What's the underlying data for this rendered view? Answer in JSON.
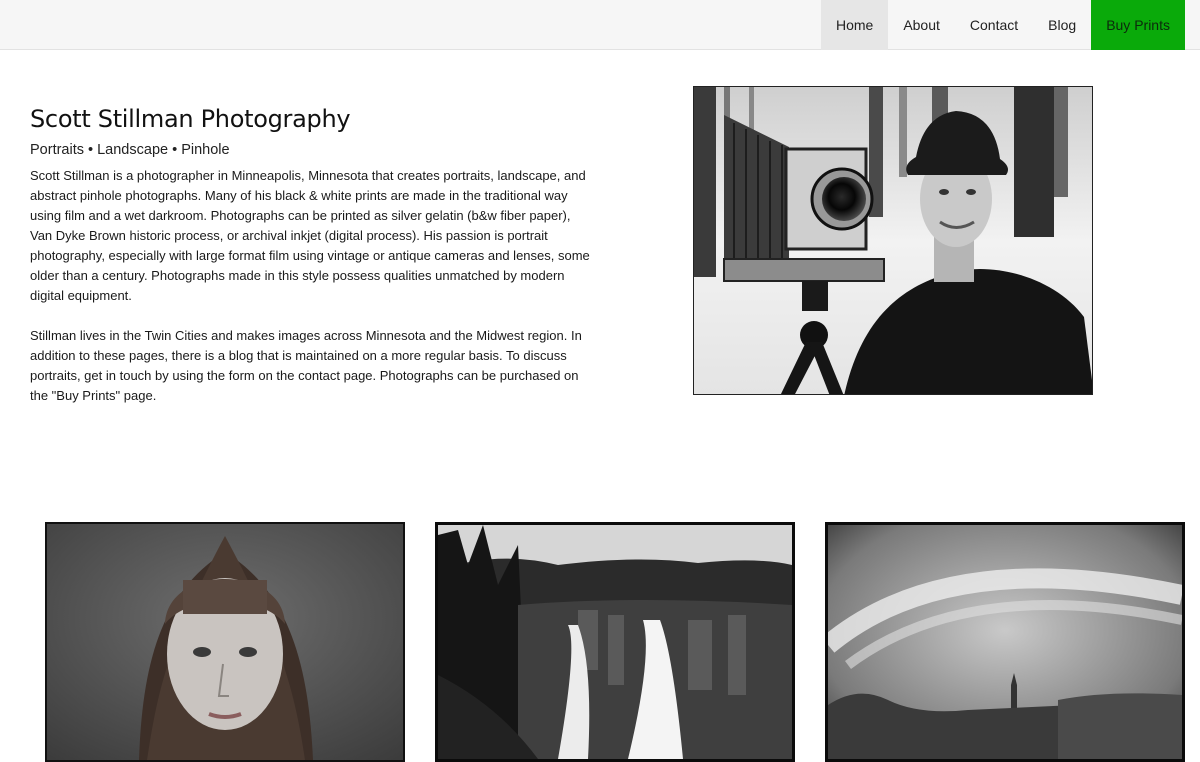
{
  "nav": {
    "items": [
      {
        "label": "Home",
        "active": true
      },
      {
        "label": "About"
      },
      {
        "label": "Contact"
      },
      {
        "label": "Blog"
      },
      {
        "label": "Buy Prints",
        "highlight": "#0aaa0a"
      }
    ]
  },
  "intro": {
    "title": "Scott Stillman Photography",
    "tagline": "Portraits • Landscape • Pinhole",
    "paragraphs": [
      "Scott Stillman is a photographer in Minneapolis, Minnesota that creates portraits, landscape, and abstract pinhole photographs. Many of his black & white prints are made in the traditional way using film and a wet darkroom. Photographs can be printed as silver gelatin (b&w fiber paper), Van Dyke Brown historic process, or archival inkjet (digital process). His passion is portrait photography, especially with large format film using vintage or antique cameras and lenses, some older than a century. Photographs made in this style possess qualities unmatched by modern digital equipment.",
      "Stillman lives in the Twin Cities and makes images across Minnesota and the Midwest region. In addition to these pages, there is a blog that is maintained on a more regular basis. To discuss portraits, get in touch by using the form on the contact page. Photographs can be purchased on the \"Buy Prints\" page."
    ]
  },
  "colors": {
    "topbar": "#f6f6f6",
    "active_nav": "#e6e6e6",
    "buy_prints": "#0aaa0a"
  }
}
